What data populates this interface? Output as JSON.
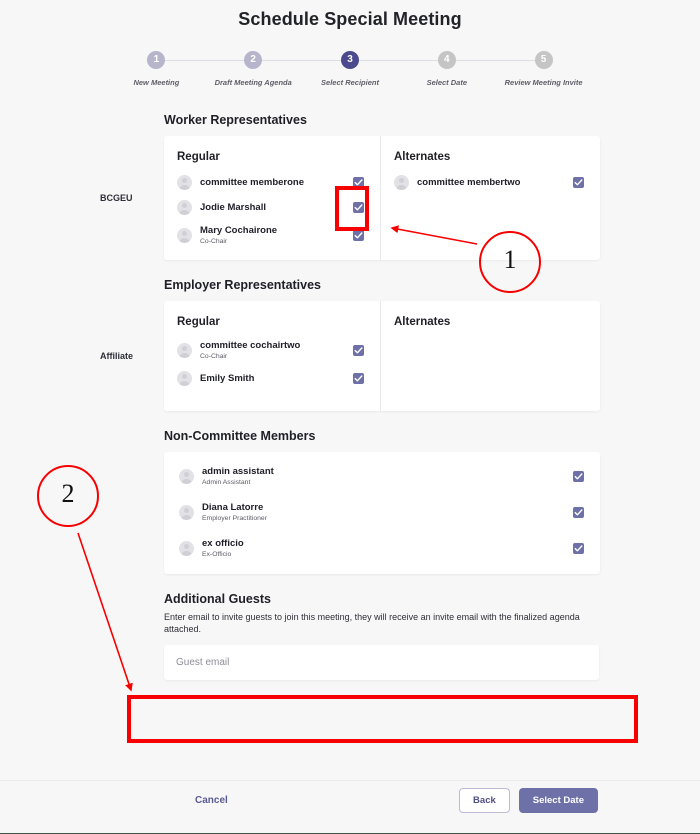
{
  "header": {
    "title": "Schedule Special Meeting"
  },
  "stepper": {
    "steps": [
      {
        "num": "1",
        "label": "New Meeting",
        "state": "light"
      },
      {
        "num": "2",
        "label": "Draft Meeting Agenda",
        "state": "light"
      },
      {
        "num": "3",
        "label": "Select Recipient",
        "state": "active"
      },
      {
        "num": "4",
        "label": "Select Date",
        "state": "gray"
      },
      {
        "num": "5",
        "label": "Review Meeting Invite",
        "state": "gray"
      }
    ]
  },
  "worker": {
    "section_title": "Worker Representatives",
    "group_label": "BCGEU",
    "regular_head": "Regular",
    "alternates_head": "Alternates",
    "regular": [
      {
        "name": "committee memberone",
        "role": "",
        "checked": true
      },
      {
        "name": "Jodie Marshall",
        "role": "",
        "checked": true
      },
      {
        "name": "Mary Cochairone",
        "role": "Co-Chair",
        "checked": true
      }
    ],
    "alternates": [
      {
        "name": "committee membertwo",
        "role": "",
        "checked": true
      }
    ]
  },
  "employer": {
    "section_title": "Employer Representatives",
    "group_label": "Affiliate",
    "regular_head": "Regular",
    "alternates_head": "Alternates",
    "regular": [
      {
        "name": "committee cochairtwo",
        "role": "Co-Chair",
        "checked": true
      },
      {
        "name": "Emily Smith",
        "role": "",
        "checked": true
      }
    ],
    "alternates": []
  },
  "non_committee": {
    "section_title": "Non-Committee Members",
    "members": [
      {
        "name": "admin assistant",
        "role": "Admin Assistant",
        "checked": true
      },
      {
        "name": "Diana Latorre",
        "role": "Employer Practitioner",
        "checked": true
      },
      {
        "name": "ex officio",
        "role": "Ex-Officio",
        "checked": true
      }
    ]
  },
  "guests": {
    "title": "Additional Guests",
    "description": "Enter email to invite guests to join this meeting, they will receive an invite email with the finalized agenda attached.",
    "input_value": "",
    "input_placeholder": "Guest email"
  },
  "footer": {
    "cancel_label": "Cancel",
    "back_label": "Back",
    "primary_label": "Select Date"
  },
  "annotations": {
    "marker_one": "1",
    "marker_two": "2",
    "highlight_color": "#f80000"
  }
}
